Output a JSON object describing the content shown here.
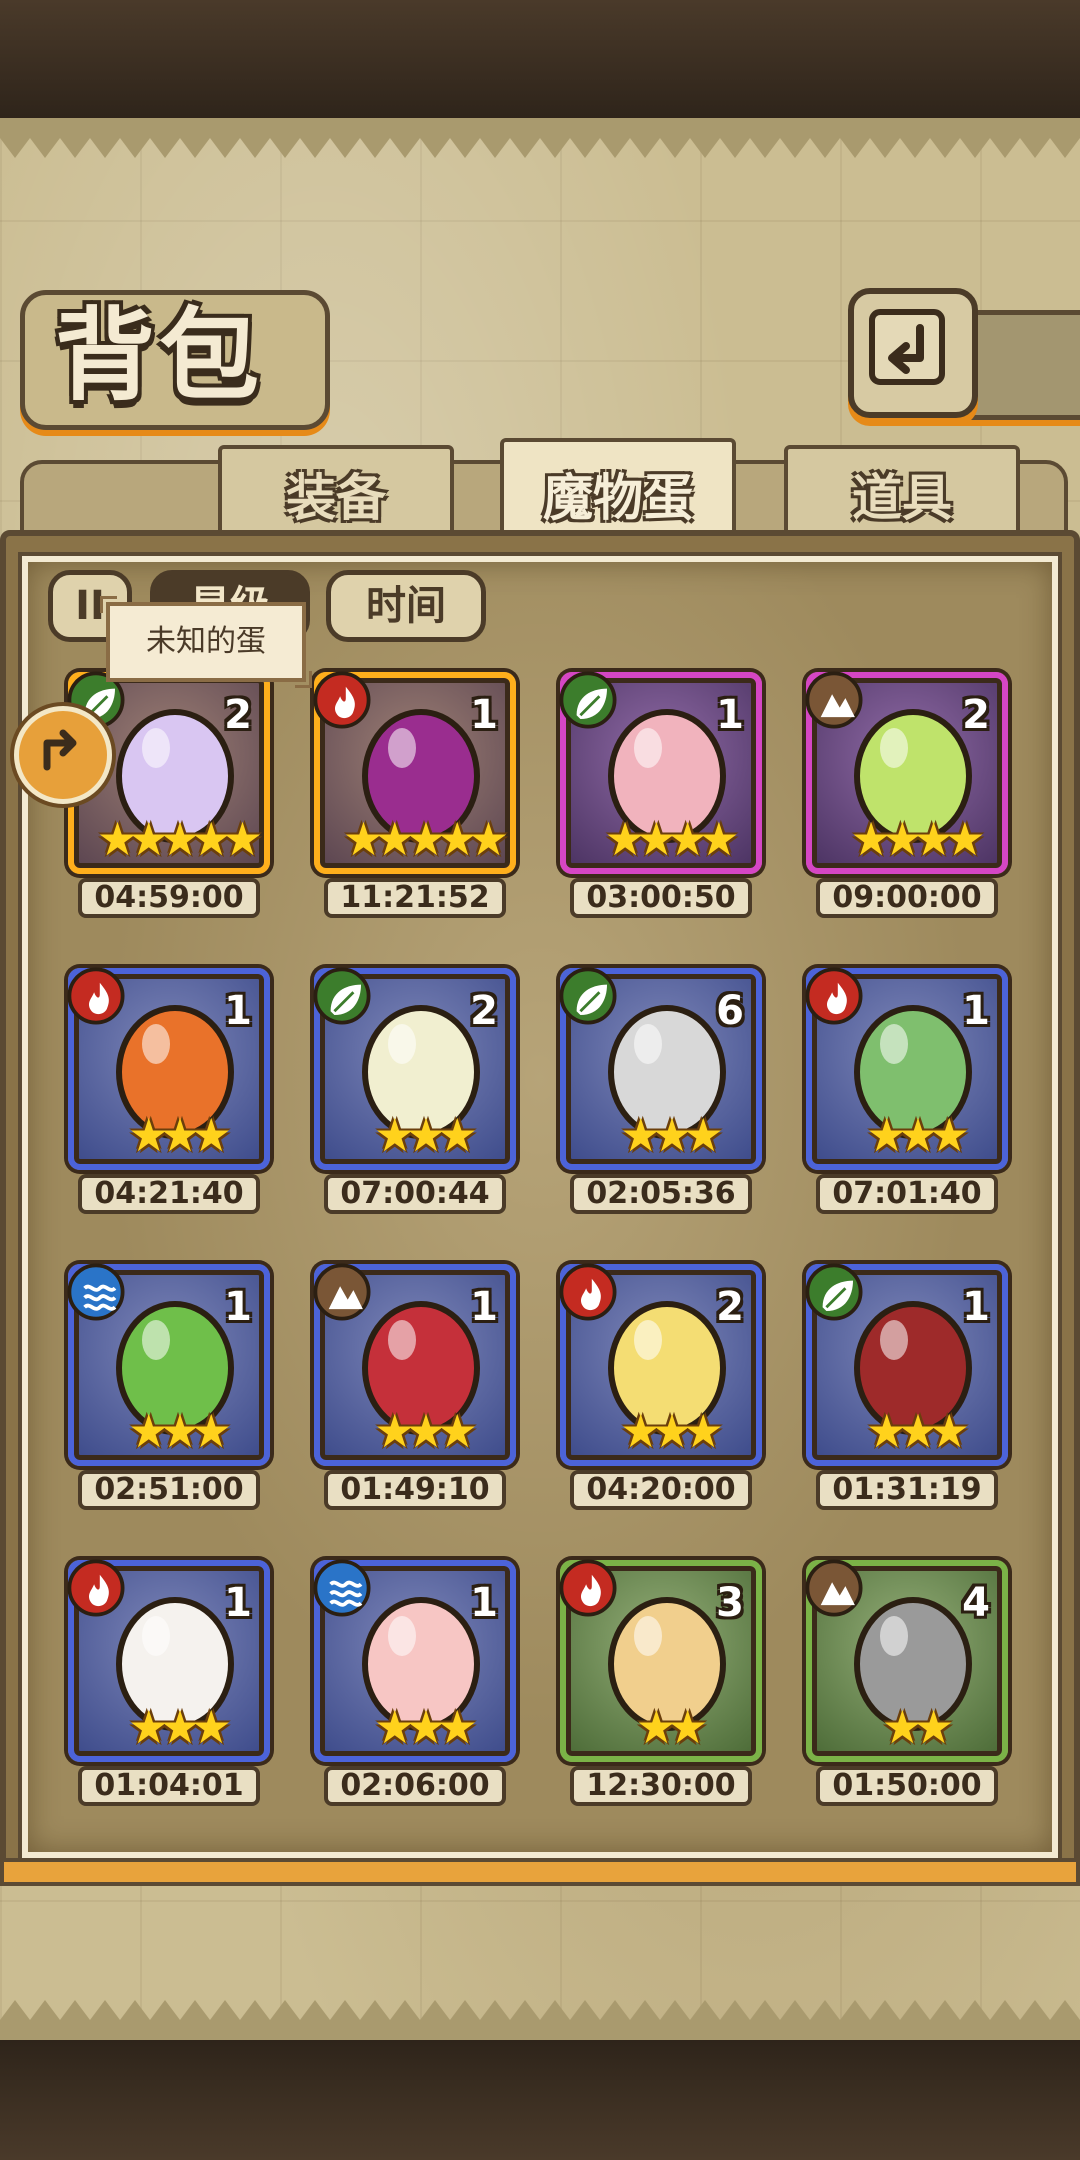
{
  "header": {
    "title": "背包"
  },
  "tabs": [
    {
      "label": "装备",
      "active": false
    },
    {
      "label": "魔物蛋",
      "active": true
    },
    {
      "label": "道具",
      "active": false
    }
  ],
  "sort": {
    "pause_label": "II",
    "level_label": "星级",
    "time_label": "时间"
  },
  "tooltip": "未知的蛋",
  "eggs": [
    {
      "element": "nature",
      "count": "2",
      "stars": "★★★★★",
      "timer": "04:59:00",
      "frame": "orange",
      "color": "#d9c6f2"
    },
    {
      "element": "fire",
      "count": "1",
      "stars": "★★★★★",
      "timer": "11:21:52",
      "frame": "orange",
      "color": "#9a2d8f"
    },
    {
      "element": "nature",
      "count": "1",
      "stars": "★★★★",
      "timer": "03:00:50",
      "frame": "purple",
      "color": "#f1b3bd"
    },
    {
      "element": "earth",
      "count": "2",
      "stars": "★★★★",
      "timer": "09:00:00",
      "frame": "purple",
      "color": "#bfe36b"
    },
    {
      "element": "fire",
      "count": "1",
      "stars": "★★★",
      "timer": "04:21:40",
      "frame": "blue",
      "color": "#e9722a"
    },
    {
      "element": "nature",
      "count": "2",
      "stars": "★★★",
      "timer": "07:00:44",
      "frame": "blue",
      "color": "#f1efd0"
    },
    {
      "element": "nature",
      "count": "6",
      "stars": "★★★",
      "timer": "02:05:36",
      "frame": "blue",
      "color": "#d8d8d8"
    },
    {
      "element": "fire",
      "count": "1",
      "stars": "★★★",
      "timer": "07:01:40",
      "frame": "blue",
      "color": "#7fbf6e"
    },
    {
      "element": "water",
      "count": "1",
      "stars": "★★★",
      "timer": "02:51:00",
      "frame": "blue",
      "color": "#6fbf4a"
    },
    {
      "element": "earth",
      "count": "1",
      "stars": "★★★",
      "timer": "01:49:10",
      "frame": "blue",
      "color": "#c5303a"
    },
    {
      "element": "fire",
      "count": "2",
      "stars": "★★★",
      "timer": "04:20:00",
      "frame": "blue",
      "color": "#f4dd73"
    },
    {
      "element": "nature",
      "count": "1",
      "stars": "★★★",
      "timer": "01:31:19",
      "frame": "blue",
      "color": "#9e2a2a"
    },
    {
      "element": "fire",
      "count": "1",
      "stars": "★★★",
      "timer": "01:04:01",
      "frame": "blue",
      "color": "#f5f2ee"
    },
    {
      "element": "water",
      "count": "1",
      "stars": "★★★",
      "timer": "02:06:00",
      "frame": "blue",
      "color": "#f7c6c4"
    },
    {
      "element": "fire",
      "count": "3",
      "stars": "★★",
      "timer": "12:30:00",
      "frame": "green",
      "color": "#f1cf8d"
    },
    {
      "element": "earth",
      "count": "4",
      "stars": "★★",
      "timer": "01:50:00",
      "frame": "green",
      "color": "#9a9a9a"
    }
  ]
}
